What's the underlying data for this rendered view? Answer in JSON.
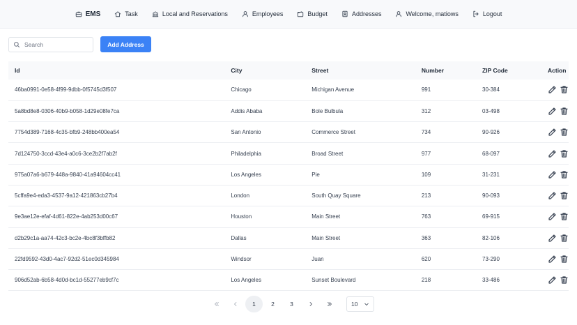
{
  "nav": {
    "brand": "EMS",
    "items": [
      "Task",
      "Local and Reservations",
      "Employees",
      "Budget",
      "Addresses",
      "Welcome, matiows",
      "Logout"
    ]
  },
  "search": {
    "placeholder": "Search"
  },
  "add_button": "Add Address",
  "table": {
    "columns": [
      "Id",
      "City",
      "Street",
      "Number",
      "ZIP Code",
      "Action"
    ],
    "rows": [
      [
        "46ba0991-0e58-4f99-9dbb-0f5745d3f507",
        "Chicago",
        "Michigan Avenue",
        "991",
        "30-384"
      ],
      [
        "5a8bd8e8-0306-40b9-b058-1d29e08fe7ca",
        "Addis Ababa",
        "Bole Bulbula",
        "312",
        "03-498"
      ],
      [
        "7754d389-7168-4c35-bfb9-248bb400ea54",
        "San Antonio",
        "Commerce Street",
        "734",
        "90-926"
      ],
      [
        "7d124750-3ccd-43e4-a0c6-3ce2b2f7ab2f",
        "Philadelphia",
        "Broad Street",
        "977",
        "68-097"
      ],
      [
        "975a07a6-b679-448a-9840-41a94604cc41",
        "Los Angeles",
        "Pie",
        "109",
        "31-231"
      ],
      [
        "5cffa9e4-eda3-4537-9a12-421863cb27b4",
        "London",
        "South Quay Square",
        "213",
        "90-093"
      ],
      [
        "9e3ae12e-efaf-4d61-822e-4ab253d00c67",
        "Houston",
        "Main Street",
        "763",
        "69-915"
      ],
      [
        "d2b29c1a-aa74-42c3-bc2e-4bc8f3bffb82",
        "Dallas",
        "Main Street",
        "363",
        "82-106"
      ],
      [
        "22fd9592-43d0-4ac7-92d2-51ec0d345984",
        "Windsor",
        "Juan",
        "620",
        "73-290"
      ],
      [
        "906d52ab-6b58-4d0d-bc1d-55277eb9cf7c",
        "Los Angeles",
        "Sunset Boulevard",
        "218",
        "33-486"
      ]
    ]
  },
  "pagination": {
    "pages": [
      "1",
      "2",
      "3"
    ],
    "current": "1",
    "page_size": "10"
  },
  "colors": {
    "accent": "#3b82f6",
    "nav_bg": "#f8f9fb"
  }
}
